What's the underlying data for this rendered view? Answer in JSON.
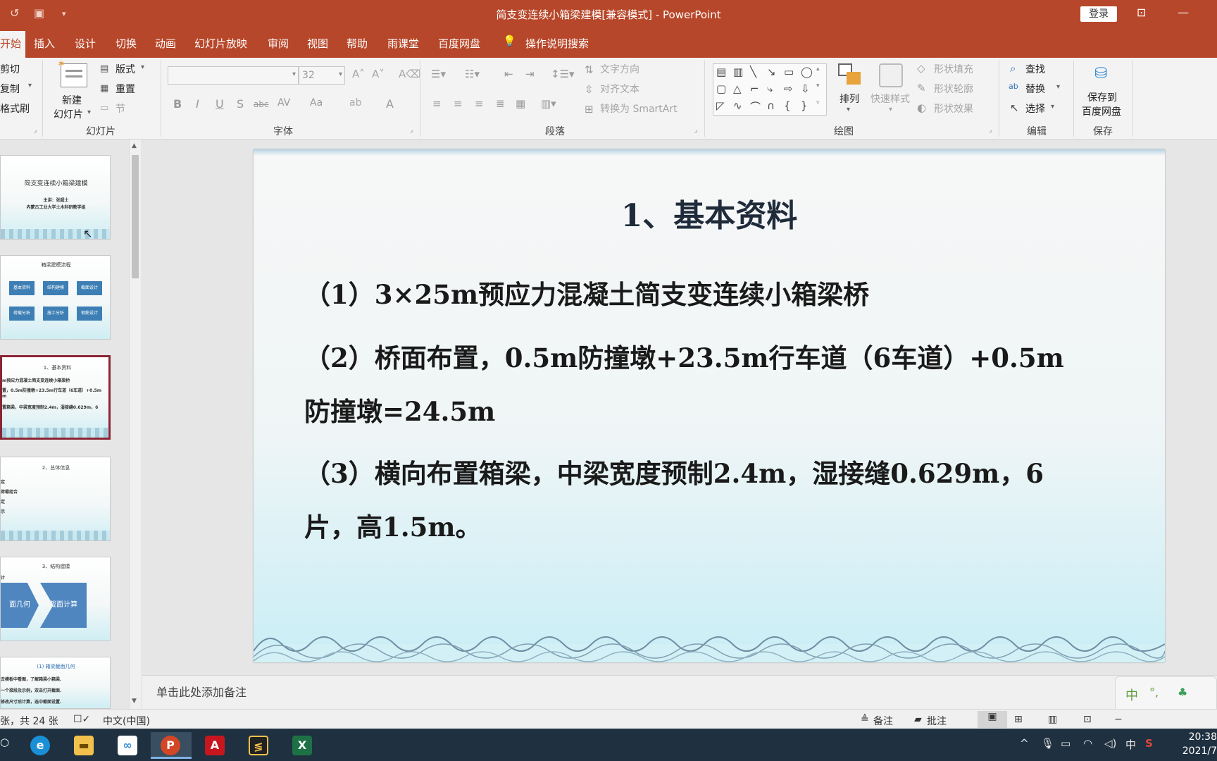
{
  "window": {
    "title": "简支变连续小箱梁建模[兼容模式]  -  PowerPoint",
    "login_label": "登录",
    "qa_icons": [
      "undo-icon",
      "present-from-start-icon",
      "customize-quick-access-icon"
    ],
    "window_icons": [
      "ribbon-display-options-icon",
      "minimize-icon"
    ]
  },
  "tabs": [
    {
      "label": "开始",
      "active": true
    },
    {
      "label": "插入"
    },
    {
      "label": "设计"
    },
    {
      "label": "切换"
    },
    {
      "label": "动画"
    },
    {
      "label": "幻灯片放映"
    },
    {
      "label": "审阅"
    },
    {
      "label": "视图"
    },
    {
      "label": "帮助"
    },
    {
      "label": "雨课堂"
    },
    {
      "label": "百度网盘"
    }
  ],
  "tell_me": "操作说明搜索",
  "ribbon": {
    "clipboard": {
      "cut": "剪切",
      "copy": "复制",
      "format_painter": "格式刷"
    },
    "slides": {
      "group": "幻灯片",
      "new_slide_line1": "新建",
      "new_slide_line2": "幻灯片",
      "layout": "版式",
      "reset": "重置",
      "section": "节"
    },
    "font": {
      "group": "字体",
      "size": "32",
      "buttons": [
        "B",
        "I",
        "U",
        "S",
        "abc",
        "AV",
        "Aa",
        "A"
      ]
    },
    "paragraph": {
      "group": "段落",
      "text_direction": "文字方向",
      "align_text": "对齐文本",
      "smartart": "转换为 SmartArt"
    },
    "drawing": {
      "group": "绘图",
      "arrange": "排列",
      "quick_styles": "快速样式",
      "shape_fill": "形状填充",
      "shape_outline": "形状轮廓",
      "shape_effects": "形状效果"
    },
    "editing": {
      "group": "编辑",
      "find": "查找",
      "replace": "替换",
      "select": "选择"
    },
    "save": {
      "group": "保存",
      "line1": "保存到",
      "line2": "百度网盘"
    }
  },
  "thumbnails": [
    {
      "title": "简支变连续小箱梁建模",
      "sub1": "主讲：张超士",
      "sub2": "内蒙古工业大学土木科研教学组"
    },
    {
      "title": "箱梁建模流程",
      "boxes": [
        "基本资料",
        "结构建模",
        "截面设计",
        "荷载分析",
        "施工分析",
        "钢筋设计"
      ]
    },
    {
      "title": "1、基本资料",
      "lines": [
        "m预应力混凝土简支变连续小箱梁桥",
        "置，0.5m防撞墩+23.5m行车道（6车道）+0.5m",
        "m",
        "置箱梁，中梁宽度预制2.4m，湿接缝0.629m，6"
      ],
      "selected": true
    },
    {
      "title": "2、总体信息",
      "lines": [
        "定",
        "荷载组合",
        "定",
        "示"
      ]
    },
    {
      "title": "3、结构建模",
      "lines": [
        "计"
      ],
      "arrows": [
        "面几何",
        "截面计算"
      ]
    },
    {
      "title": "(1) 箱梁截面几何",
      "lines": [
        "去模板中看图，了解箱梁小箱梁.",
        "一个梁段及示例，双击打开截面.",
        "修改尺寸后计算，选中截面设置."
      ]
    }
  ],
  "slide": {
    "title": "1、基本资料",
    "items": [
      "（1）3×25m预应力混凝土简支变连续小箱梁桥",
      "（2）桥面布置，0.5m防撞墩+23.5m行车道（6车道）+0.5m",
      "防撞墩=24.5m",
      "（3）横向布置箱梁，中梁宽度预制2.4m，湿接缝0.629m，6",
      "片，高1.5m。"
    ]
  },
  "notes_placeholder": "单击此处添加备注",
  "status": {
    "slide_count": "张，共 24 张",
    "language": "中文(中国)",
    "notes": "备注",
    "comments": "批注"
  },
  "taskbar": {
    "apps": [
      "edge-icon",
      "file-explorer-icon",
      "baidu-netdisk-icon",
      "powerpoint-icon",
      "autocad-icon",
      "app-icon",
      "excel-icon"
    ],
    "ime_lang": "中",
    "time": "20:38",
    "date": "2021/7"
  },
  "colors": {
    "accent": "#b7472a",
    "taskbar": "#1f3141",
    "selected_thumb": "#8b2535"
  }
}
